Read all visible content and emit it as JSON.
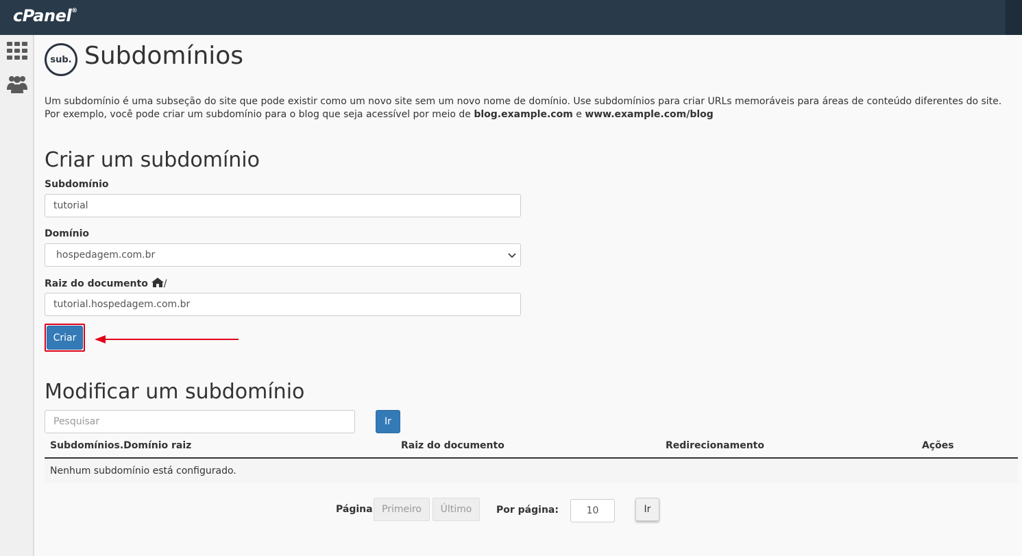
{
  "header": {
    "logo_text": "cPanel",
    "logo_mark": "®"
  },
  "sidebar": {
    "items": [
      {
        "icon": "grid-apps-icon"
      },
      {
        "icon": "users-icon"
      }
    ]
  },
  "page": {
    "icon_text": "sub.",
    "title": "Subdomínios",
    "intro_part1": "Um subdomínio é uma subseção do site que pode existir como um novo site sem um novo nome de domínio. Use subdomínios para criar URLs memoráveis para áreas de conteúdo diferentes do site. Por exemplo, você pode criar um subdomínio para o blog que seja acessível por meio de ",
    "intro_bold1": "blog.example.com",
    "intro_part2": " e ",
    "intro_bold2": "www.example.com/blog"
  },
  "create": {
    "heading": "Criar um subdomínio",
    "subdomain_label": "Subdomínio",
    "subdomain_value": "tutorial",
    "domain_label": "Domínio",
    "domain_selected": "hospedagem.com.br",
    "docroot_label": "Raiz do documento",
    "docroot_suffix": "/",
    "docroot_value": "tutorial.hospedagem.com.br",
    "submit_label": "Criar"
  },
  "modify": {
    "heading": "Modificar um subdomínio",
    "search_placeholder": "Pesquisar",
    "search_button": "Ir",
    "columns": [
      "Subdomínios.Domínio raiz",
      "Raiz do documento",
      "Redirecionamento",
      "Ações"
    ],
    "empty_message": "Nenhum subdomínio está configurado."
  },
  "pagination": {
    "page_label": "Página:",
    "first": "Primeiro",
    "last": "Último",
    "per_page_label": "Por página:",
    "per_page_value": "10",
    "go_button": "Ir"
  },
  "colors": {
    "header_bg": "#293a4a",
    "primary": "#337ab7",
    "highlight": "#e0001b"
  }
}
